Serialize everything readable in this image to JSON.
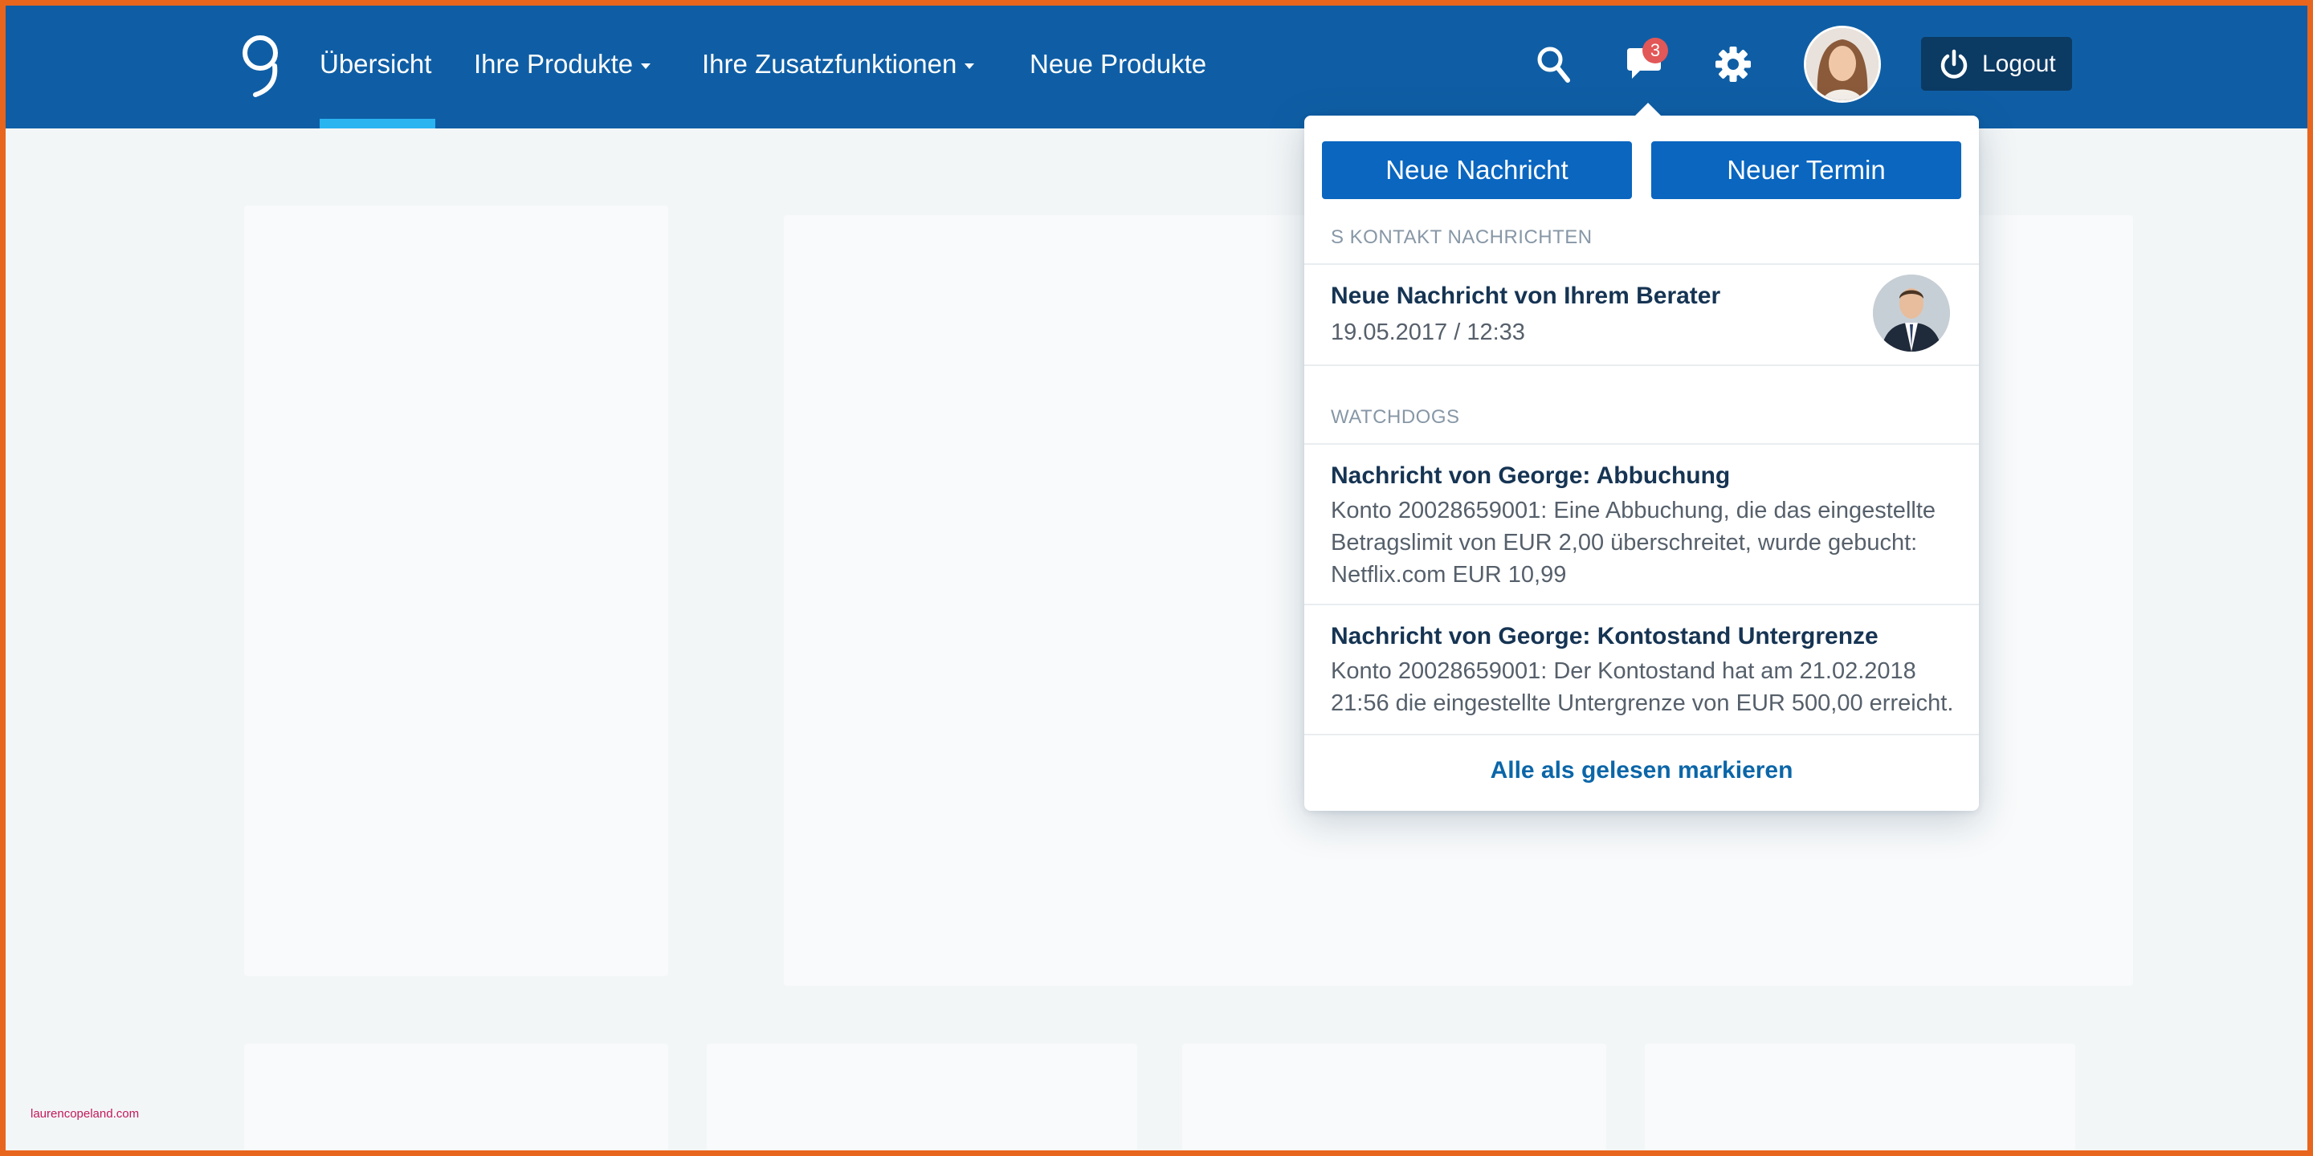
{
  "header": {
    "nav": [
      {
        "label": "Übersicht",
        "active": true
      },
      {
        "label": "Ihre Produkte",
        "dropdown": true
      },
      {
        "label": "Ihre Zusatzfunktionen",
        "dropdown": true
      },
      {
        "label": "Neue Produkte"
      }
    ],
    "icons": [
      "search-icon",
      "chat-icon",
      "gear-icon"
    ],
    "message_badge": "3",
    "logout_label": "Logout"
  },
  "dropdown": {
    "new_message_button": "Neue Nachricht",
    "new_appointment_button": "Neuer Termin",
    "s_kontakt": {
      "heading": "S KONTAKT NACHRICHTEN",
      "items": [
        {
          "title": "Neue Nachricht von Ihrem Berater",
          "date": "19.05.2017 / 12:33"
        }
      ]
    },
    "watchdogs": {
      "heading": "WATCHDOGS",
      "items": [
        {
          "title": "Nachricht von George: Abbuchung",
          "text": "Konto 20028659001: Eine Abbuchung, die das eingestellte Betragslimit von EUR 2,00 überschreitet, wurde gebucht: Netflix.com EUR 10,99"
        },
        {
          "title": "Nachricht von George: Kontostand Untergrenze",
          "text": "Konto 20028659001: Der Kontostand hat am 21.02.2018 21:56 die eingestellte Untergrenze von EUR 500,00 erreicht."
        }
      ]
    },
    "mark_all_read": "Alle als gelesen markieren"
  },
  "watermark": "laurencopeland.com",
  "colors": {
    "header_bg": "#0f5ea5",
    "active_indicator": "#2ab4f0",
    "primary_button": "#0a66bf",
    "logout_bg": "#0b3a63",
    "badge": "#e25757",
    "frame": "#e8651e"
  }
}
